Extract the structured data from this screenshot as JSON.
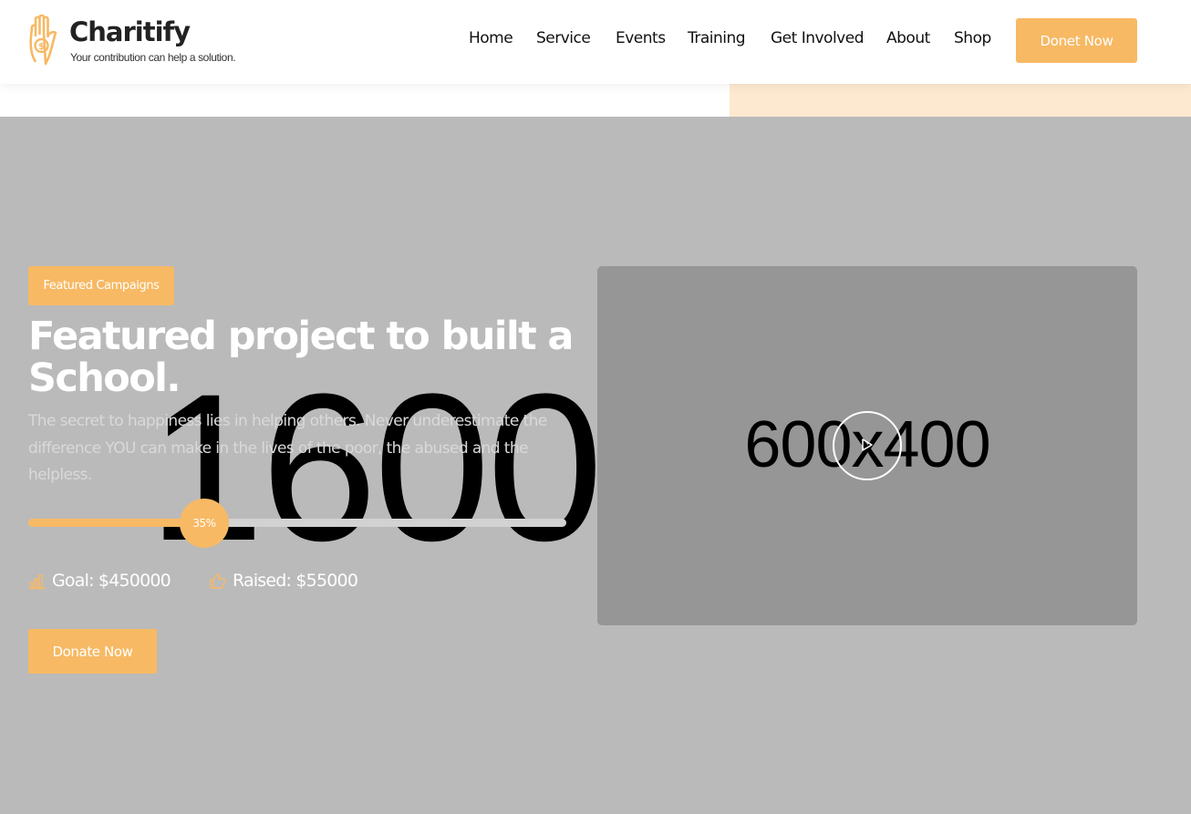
{
  "brand": {
    "name": "Charitify",
    "tagline": "Your contribution can help a solution.",
    "color": "#f7b964"
  },
  "nav": {
    "items": [
      {
        "label": "Home"
      },
      {
        "label": "Service"
      },
      {
        "label": "Events"
      },
      {
        "label": "Training"
      },
      {
        "label": "Get Involved"
      },
      {
        "label": "About"
      },
      {
        "label": "Shop"
      }
    ],
    "cta_label": "Donet Now"
  },
  "hero": {
    "background_placeholder": "1600x",
    "badge": "Featured Campaigns",
    "title": "Featured project to built a School.",
    "description": "The secret to happiness lies in helping others. Never underestimate the difference YOU can make in the lives of the poor, the abused and the helpless.",
    "progress_percent": 35,
    "progress_label": "35%",
    "goal_label": "Goal: $450000",
    "raised_label": "Raised: $55000",
    "goal_icon": "bar-chart-icon",
    "raised_icon": "thumbs-up-icon",
    "donate_label": "Donate Now",
    "video": {
      "placeholder": "600x400",
      "play_icon": "play-icon"
    }
  }
}
